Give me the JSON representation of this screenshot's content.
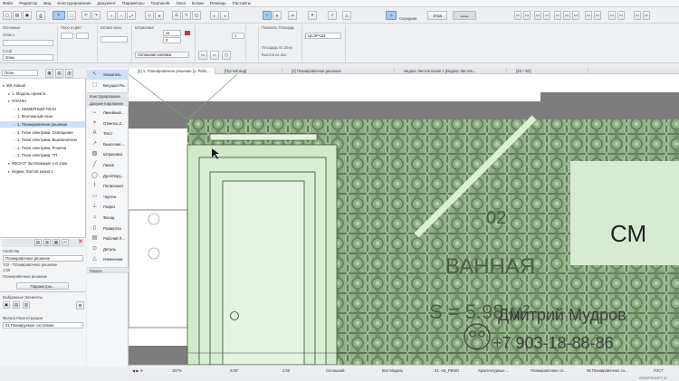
{
  "menu": [
    "Файл",
    "Редактор",
    "Вид",
    "Конструирование",
    "Документ",
    "Параметры",
    "Teamwork",
    "Окно",
    "Блоки",
    "Помощь",
    "Растайты"
  ],
  "toolbar": {
    "mode_label": "Середина",
    "nav_combo": "Этаж"
  },
  "info_box": {
    "general_label": "Основные",
    "floor_label": "Этаж 1",
    "layer_label": "Слой",
    "layer_value": "Зоны",
    "pen_label": "Перо и цвет",
    "fill_value": "Сплошная заливка",
    "stamp_label": "Штамп зоны",
    "height_value_1": "41",
    "height_value_2": "0",
    "story_value": "1",
    "area_label": "Площадь по Зоне",
    "area_label_2": "Высота из Зон",
    "calc_label": "Показать Площадь",
    "calc_value": "ЦСЭР-Ш3",
    "hatch_label": "Штриховка"
  },
  "navigator": {
    "combo": "План",
    "items": [
      {
        "label": "ЖК Новый",
        "level": 0,
        "selected": false
      },
      {
        "label": "1. Модель проекта",
        "level": 1,
        "selected": false
      },
      {
        "label": "ПЛАНЫ",
        "level": 1,
        "selected": false
      },
      {
        "label": "1. ОБМЕРНЫЙ ПЛАН",
        "level": 2,
        "selected": false
      },
      {
        "label": "1. Монтажный план",
        "level": 2,
        "selected": false
      },
      {
        "label": "1. Планировочное решение",
        "level": 2,
        "selected": true
      },
      {
        "label": "1. План электрики. Освещение",
        "level": 2,
        "selected": false
      },
      {
        "label": "1. План электрики. Выключатели",
        "level": 2,
        "selected": false
      },
      {
        "label": "1. План электрики. Розетки",
        "level": 2,
        "selected": false
      },
      {
        "label": "1. План электрики. ТП",
        "level": 2,
        "selected": false
      },
      {
        "label": "ЖЕЭ-07 Экспликация 1-й этаж",
        "level": 1,
        "selected": false
      },
      {
        "label": "Индекс Листов копия 1",
        "level": 1,
        "selected": false
      }
    ]
  },
  "palette": {
    "top_items": [
      "Указатель",
      "Бегущая Ра..."
    ],
    "sec_construct": "Конструирование",
    "sec_document": "Документирование",
    "doc_items": [
      "Линейный...",
      "Отметка Z...",
      "Текст",
      "Выносная ...",
      "Штриховка",
      "Линия",
      "Дуга/Окру...",
      "Полилиния",
      "Чертеж",
      "Разрез",
      "Фасад",
      "Развертка",
      "Рабочий Л...",
      "Деталь",
      "Изменение"
    ],
    "sec_other": "Разное"
  },
  "properties": {
    "title": "Свойства",
    "view_value": "Планировочное решение",
    "id_label": "Т02 - Планировочное решение",
    "scale": "1:50",
    "view_name": "Планировочное решение",
    "settings_button": "Параметры..."
  },
  "selection": {
    "title": "Выбранные Элементы",
    "filter_label": "Фильтр Реконструкции",
    "filter_value": "01 Планируемое состояние"
  },
  "tabs": [
    "[2] 1. Планировочное решение [1. Рабо...",
    "[Пустой вид]",
    "[3] Планировочное решение",
    "Индекс Листов копия 1 [Индекс Листов...",
    "[2D / 3D]"
  ],
  "canvas_labels": {
    "room_number": "02",
    "room_name": "ВАННАЯ",
    "area": "S = 5.98 м²",
    "side_label": "СМ",
    "watermark_name": "Дмитрий Мудров",
    "watermark_phone": "+7 903-18-88-86"
  },
  "status_bar": {
    "zoom": "157%",
    "angle": "0,00°",
    "scale": "1:50",
    "fill": "Сплошной",
    "model": "Вся Модель",
    "layer": "01. АБ_РЕМО",
    "view": "Архитектурные ...",
    "structure": "Планировочное со...",
    "state": "05 Планировочное со...",
    "gost": "ГОСТ",
    "brand": "GRAPHISOFT ID"
  },
  "colors": {
    "tile_green": "#8fae86",
    "tile_dark": "#5f7f58",
    "room_light": "#cfe9c9",
    "wall_gray": "#7d7d7d",
    "selected_blue": "#cfe0f6"
  }
}
